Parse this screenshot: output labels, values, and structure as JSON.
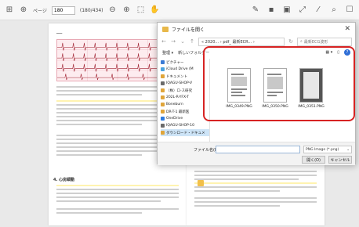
{
  "toolbar": {
    "page_label": "ページ",
    "page_value": "180",
    "page_total": "(180/434)",
    "icons": [
      "grid-icon",
      "target-icon",
      "zoom-out-icon",
      "zoom-in-icon",
      "fit-page-icon",
      "hand-icon",
      "pen-icon",
      "save-icon",
      "image-icon",
      "expand-icon",
      "stylus-icon",
      "search-icon",
      "window-icon"
    ]
  },
  "document": {
    "section_heading": "4. 心房細動"
  },
  "dialog": {
    "title": "ファイルを開く",
    "address": "« 2020...  › pdf_  最新ECR...  ›",
    "search_placeholder": "最新ECG波形",
    "cmd_organize": "整理 ▾",
    "cmd_new_folder": "新しいフォルダー",
    "nav_items": [
      {
        "label": "ピクチャー",
        "color": "#3a7bd5"
      },
      {
        "label": "iCloud Drive (M",
        "color": "#4aa3e0"
      },
      {
        "label": "ドキュメント",
        "color": "#e0a53a"
      },
      {
        "label": "IQAGU-SHOP-V",
        "color": "#6a6a6a"
      },
      {
        "label": "（株）ロ-ス研究",
        "color": "#e0a53a"
      },
      {
        "label": "202L-R-YFX-T",
        "color": "#e0a53a"
      },
      {
        "label": "Boneburn",
        "color": "#e0a53a"
      },
      {
        "label": "DR-T-1 最新医",
        "color": "#e0a53a"
      },
      {
        "label": "OneDrive",
        "color": "#2d7be0"
      },
      {
        "label": "IQAGU-SHOP-10",
        "color": "#6a6a6a"
      },
      {
        "label": "ダウンロード・ドキュメ",
        "color": "#e0a53a"
      }
    ],
    "files": [
      {
        "name": "IMG_0349.PNG"
      },
      {
        "name": "IMG_0350.PNG"
      },
      {
        "name": "IMG_0351.PNG"
      }
    ],
    "filename_label": "ファイル名(N):",
    "filename_value": "",
    "filetype_value": "PNG Image (*.png)",
    "open_button": "開く(O)",
    "cancel_button": "キャンセル"
  }
}
